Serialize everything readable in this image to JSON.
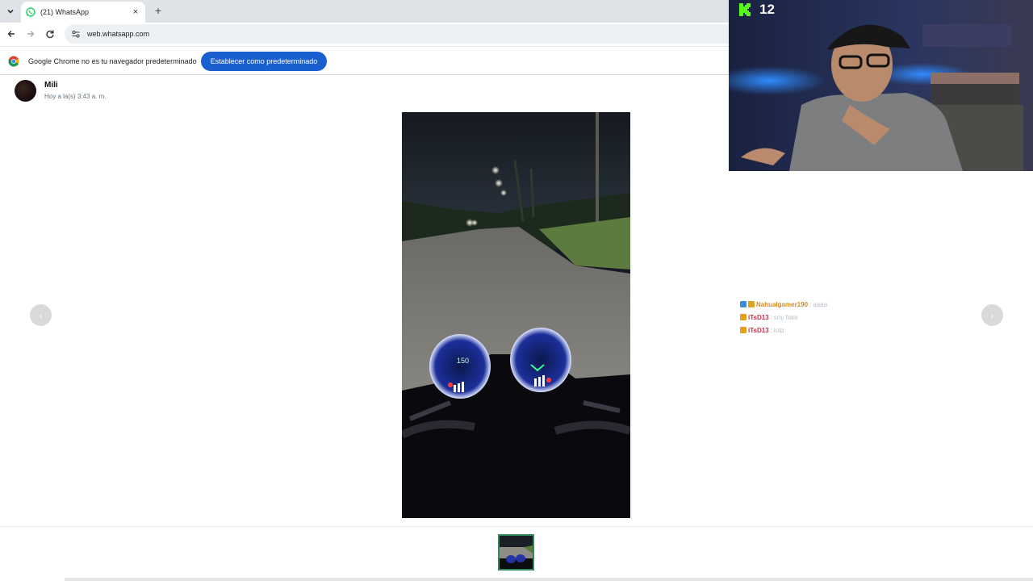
{
  "browser": {
    "tab_title": "(21) WhatsApp",
    "tab_close": "×",
    "new_tab": "+",
    "url": "web.whatsapp.com",
    "infobar_message": "Google Chrome no es tu navegador predeterminado",
    "infobar_button": "Establecer como predeterminado"
  },
  "viewer": {
    "sender_name": "Mili",
    "timestamp": "Hoy a la(s) 3:43 a. m.",
    "prev_arrow": "‹",
    "next_arrow": "›"
  },
  "dashboard": {
    "speed_reading": "150"
  },
  "stream": {
    "viewer_count": "12",
    "chat": [
      {
        "user": "Nahualgamer190",
        "message": "aaaa",
        "color": "#d48a1e"
      },
      {
        "user": "iTsD13",
        "message": "soy fake",
        "color": "#c0304a"
      },
      {
        "user": "iTsD13",
        "message": "lolp",
        "color": "#c0304a"
      }
    ]
  },
  "colors": {
    "primary_button": "#1a5fd0",
    "kick_green": "#53fc18",
    "thumb_border": "#2e8b57"
  }
}
